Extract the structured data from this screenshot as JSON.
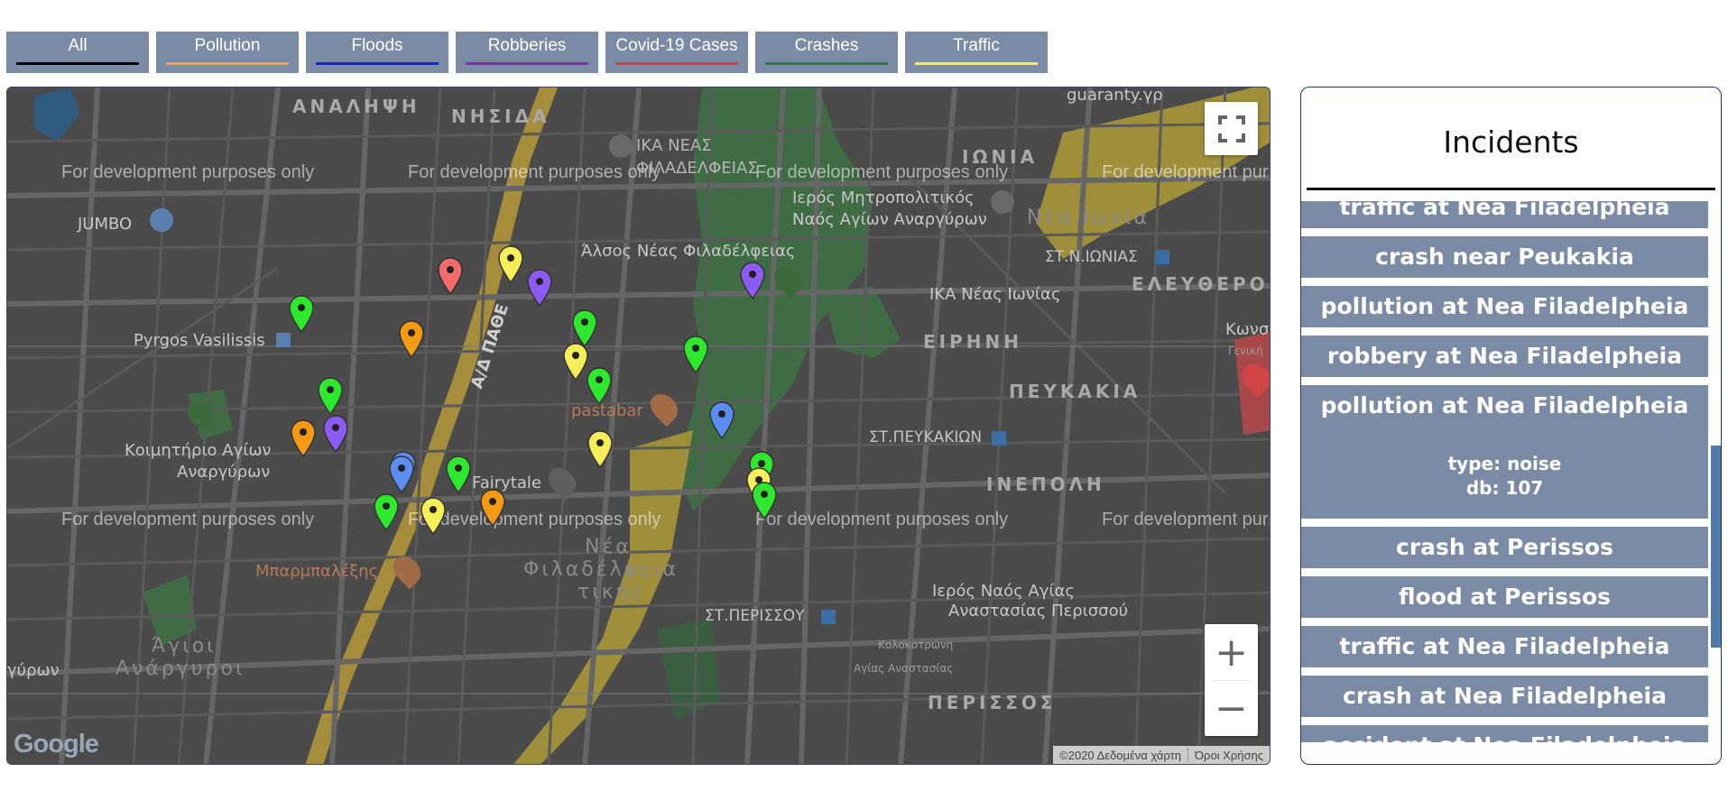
{
  "tabs": [
    {
      "label": "All",
      "color": "#000000"
    },
    {
      "label": "Pollution",
      "color": "#f5a623"
    },
    {
      "label": "Floods",
      "color": "#1a1aff"
    },
    {
      "label": "Robberies",
      "color": "#8e24aa"
    },
    {
      "label": "Covid-19 Cases",
      "color": "#e53935"
    },
    {
      "label": "Crashes",
      "color": "#2e7d32"
    },
    {
      "label": "Traffic",
      "color": "#ffee33"
    }
  ],
  "map": {
    "dev_text": "For development purposes only",
    "labels": {
      "analipsi": "ΑΝΑΛΗΨΗ",
      "nisida": "ΝΗΣΙΔΑ",
      "ika_neas": "ΙΚΑ ΝΕΑΣ",
      "filadelfeias": "ΦΙΛΑΔΕΛΦΕΙΑΣ",
      "ionia": "ΙΩΝΙΑ",
      "guaranty": "guaranty.γρ",
      "jumbo": "JUMBO",
      "metropolitikos1": "Ιερός Μητροπολιτικός",
      "metropolitikos2": "Ναός Αγίων Αναργύρων",
      "nea_ionia": "Νέα Ιωνία",
      "alsos": "Άλσος Νέας Φιλαδέλφειας",
      "st_nionias": "ΣΤ.Ν.ΙΩΝΙΑΣ",
      "eleftheroupoli": "ΕΛΕΥΘΕΡΟ",
      "ika_neas_ionias": "ΙΚΑ Νέας Ιωνίας",
      "pyrgos": "Pyrgos Vasilissis",
      "eirini": "ΕΙΡΗΝΗ",
      "peukakia": "ΠΕΥΚΑΚΙΑ",
      "pastabar": "pastabar",
      "koimitirio1": "Κοιμητήριο Αγίων",
      "koimitirio2": "Αναργύρων",
      "st_peukakion": "ΣΤ.ΠΕΥΚΑΚΙΩΝ",
      "fairytale": "Fairytale",
      "inepoli": "ΙΝΕΠΟΛΗ",
      "nea": "Νέα",
      "filadelfeia": "Φιλαδέλφεια",
      "attikis": "τικής",
      "mparmpalexis": "Μπαρμπαλέξης",
      "naos_agias1": "Ιερός Ναός Αγίας",
      "naos_agias2": "Αναστασίας Περισσού",
      "st_perissou": "ΣΤ.ΠΕΡΙΣΣΟΥ",
      "agioi": "Άγιοι",
      "anargyroi": "Ανάργυροι",
      "perissos": "ΠΕΡΙΣΣΟΣ",
      "kolokotroni": "Κολοκοτρώνη",
      "agias_anastasias": "Αγίας Αναστασίας",
      "gyron": "γύρων",
      "kono": "Κωνσ",
      "geniki": "Γενική",
      "apdathe": "Α/Δ ΠΑΘΕ"
    },
    "markers": [
      {
        "category": "crash",
        "color": "#2ee82e"
      },
      {
        "category": "covid",
        "color": "#f36b6b"
      },
      {
        "category": "traffic",
        "color": "#f5ee58"
      },
      {
        "category": "robbery",
        "color": "#8c5cf2"
      },
      {
        "category": "pollution",
        "color": "#f59a14"
      },
      {
        "category": "crash",
        "color": "#2ee82e"
      },
      {
        "category": "traffic",
        "color": "#f5ee58"
      },
      {
        "category": "crash",
        "color": "#2ee82e"
      },
      {
        "category": "flood",
        "color": "#5b8ef0"
      },
      {
        "category": "robbery",
        "color": "#8c5cf2"
      },
      {
        "category": "crash",
        "color": "#2ee82e"
      },
      {
        "category": "crash",
        "color": "#2ee82e"
      },
      {
        "category": "pollution",
        "color": "#f59a14"
      },
      {
        "category": "robbery",
        "color": "#8c5cf2"
      },
      {
        "category": "flood",
        "color": "#5b8ef0"
      },
      {
        "category": "crash",
        "color": "#2ee82e"
      },
      {
        "category": "traffic",
        "color": "#f5ee58"
      },
      {
        "category": "crash",
        "color": "#2ee82e"
      },
      {
        "category": "traffic",
        "color": "#f5ee58"
      },
      {
        "category": "pollution",
        "color": "#f59a14"
      },
      {
        "category": "flood",
        "color": "#5b8ef0"
      },
      {
        "category": "crash",
        "color": "#2ee82e"
      },
      {
        "category": "traffic",
        "color": "#f5ee58"
      },
      {
        "category": "crash",
        "color": "#2ee82e"
      }
    ],
    "fullscreen_icon": "fullscreen-icon",
    "zoom_in": "+",
    "zoom_out": "−",
    "attribution_data": "©2020 Δεδομένα χάρτη",
    "attribution_terms": "Όροι Χρήσης",
    "logo": "Google"
  },
  "panel": {
    "title": "Incidents",
    "items": [
      {
        "title": "traffic at Nea Filadelpheia"
      },
      {
        "title": "crash near Peukakia"
      },
      {
        "title": "pollution at Nea Filadelpheia"
      },
      {
        "title": "robbery at Nea Filadelpheia"
      },
      {
        "title": "pollution at Nea Filadelpheia",
        "type": "type: noise",
        "db": "db: 107"
      },
      {
        "title": "crash at Perissos"
      },
      {
        "title": "flood at Perissos"
      },
      {
        "title": "traffic at Nea Filadelpheia"
      },
      {
        "title": "crash at Nea Filadelpheia"
      },
      {
        "title": "accident at Nea Filadelpheia"
      }
    ]
  }
}
